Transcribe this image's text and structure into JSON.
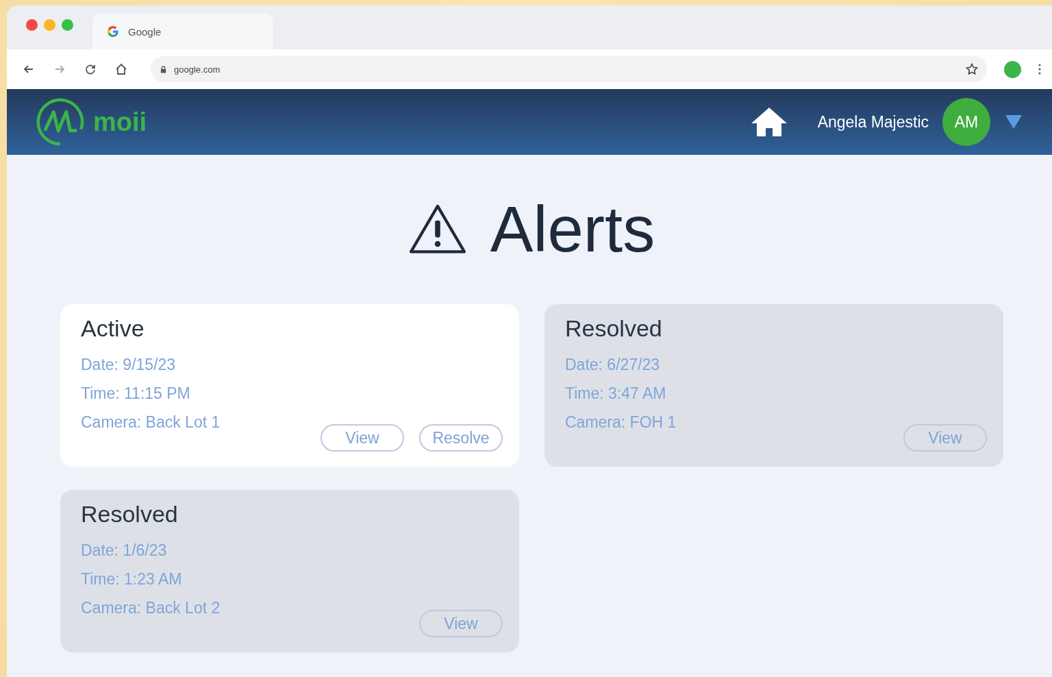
{
  "browser": {
    "tab_title": "Google",
    "url": "google.com"
  },
  "header": {
    "brand": "moii",
    "user_name": "Angela Majestic",
    "avatar_initials": "AM"
  },
  "page_title": "Alerts",
  "alerts": [
    {
      "kind": "active",
      "status": "Active",
      "date": "Date: 9/15/23",
      "time": "Time: 11:15 PM",
      "camera": "Camera: Back Lot 1",
      "buttons": [
        "View",
        "Resolve"
      ]
    },
    {
      "kind": "resolved",
      "status": "Resolved",
      "date": "Date: 6/27/23",
      "time": "Time: 3:47 AM",
      "camera": "Camera: FOH 1",
      "buttons": [
        "View"
      ]
    },
    {
      "kind": "resolved",
      "status": "Resolved",
      "date": "Date: 1/6/23",
      "time": "Time: 1:23 AM",
      "camera": "Camera: Back Lot 2",
      "buttons": [
        "View"
      ]
    }
  ]
}
